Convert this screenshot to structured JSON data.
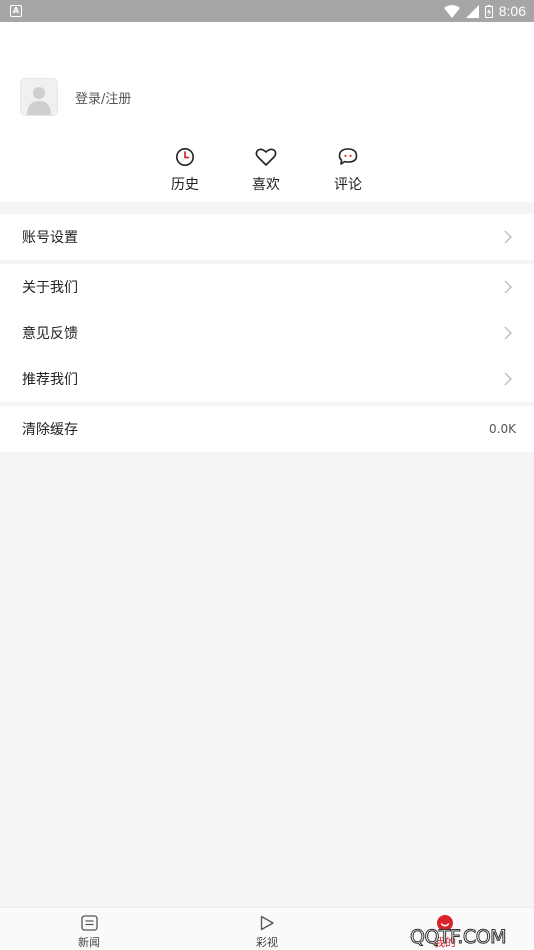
{
  "status_bar": {
    "time": "8:06"
  },
  "profile": {
    "login_label": "登录/注册"
  },
  "quick_actions": [
    {
      "label": "历史",
      "icon": "clock-icon"
    },
    {
      "label": "喜欢",
      "icon": "heart-icon"
    },
    {
      "label": "评论",
      "icon": "comment-icon"
    }
  ],
  "menu": {
    "account_settings": "账号设置",
    "about_us": "关于我们",
    "feedback": "意见反馈",
    "recommend_us": "推荐我们",
    "clear_cache": "清除缓存",
    "cache_size": "0.0K"
  },
  "bottom_nav": [
    {
      "label": "新闻",
      "icon": "news-icon"
    },
    {
      "label": "彩视",
      "icon": "play-icon"
    },
    {
      "label": "我的",
      "icon": "profile-icon"
    }
  ],
  "watermark": "QQTF.COM",
  "colors": {
    "accent": "#d9232a",
    "status_bar": "#a6a6a6"
  }
}
